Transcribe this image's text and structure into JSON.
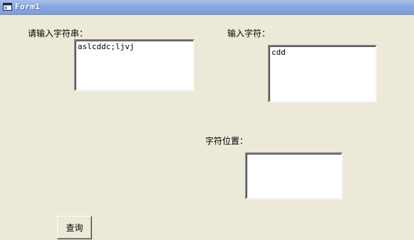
{
  "window": {
    "title": "Form1",
    "icon": "form-window-icon"
  },
  "form": {
    "string_label": "请输入字符串：",
    "string_value": "aslcddc;ljvj",
    "char_label": "输入字符：",
    "char_value": "cdd",
    "position_label": "字符位置：",
    "position_value": "",
    "query_button": "查询"
  },
  "colors": {
    "form_background": "#ece9d8",
    "titlebar": "#8aa8e0"
  }
}
